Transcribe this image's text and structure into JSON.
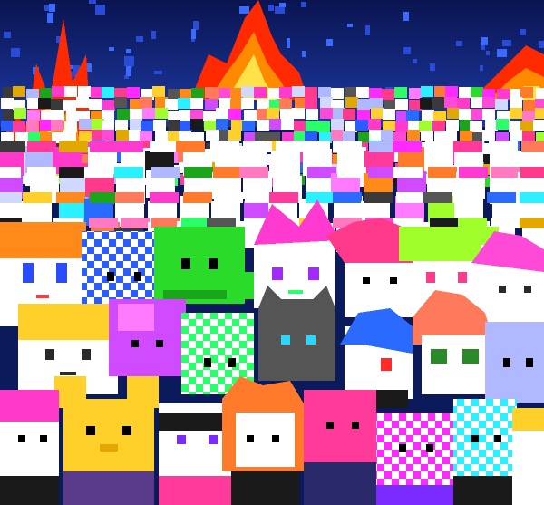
{
  "scene": {
    "palette": {
      "sky_top": "#0a1450",
      "sky_bottom": "#1d3aa5",
      "fire_outer": "#ff2a00",
      "fire_mid": "#ff8a00",
      "fire_core": "#ffe14a"
    },
    "characters": [
      {
        "name": "orange-hair-kid",
        "skin": "#ffffff",
        "hair": "#ff8a1a",
        "eye": "#2a4cff"
      },
      {
        "name": "blue-checker-head",
        "skin": "#2a5cff",
        "hair": "#ffffff",
        "eye": "#000000"
      },
      {
        "name": "green-dinosaur",
        "skin": "#2adb2a",
        "hair": "#1aa51a",
        "eye": "#000000"
      },
      {
        "name": "pink-flame-cat",
        "skin": "#ffffff",
        "hair": "#ff3ad0",
        "eye": "#a02aff"
      },
      {
        "name": "pink-hair-girl",
        "skin": "#ffffff",
        "hair": "#ff3a8a",
        "eye": "#000000"
      },
      {
        "name": "lime-hair-girl",
        "skin": "#ffffff",
        "hair": "#a0ff2a",
        "eye": "#ff3a8a"
      },
      {
        "name": "magenta-ghost",
        "skin": "#ffffff",
        "hair": "#ff4ad8",
        "eye": "#2a2a2a"
      },
      {
        "name": "yellow-hair-boy",
        "skin": "#ffffff",
        "hair": "#ffd02a",
        "eye": "#2a2a2a"
      },
      {
        "name": "purple-blob",
        "skin": "#d04aff",
        "hair": "#ff7aff",
        "eye": "#000000"
      },
      {
        "name": "green-checker-kid",
        "skin": "#ffffff",
        "hair": "#2aff6a",
        "eye": "#000000"
      },
      {
        "name": "gray-cat",
        "skin": "#555555",
        "hair": "#3a3a3a",
        "eye": "#2ad8ff"
      },
      {
        "name": "blue-hair-vampire",
        "skin": "#ffffff",
        "hair": "#2a6aff",
        "eye": "#ff2a2a"
      },
      {
        "name": "salmon-hair-skull",
        "skin": "#ffffff",
        "hair": "#ff7a5a",
        "eye": "#2a8a2a"
      },
      {
        "name": "lavender-kid",
        "skin": "#b0b8ff",
        "hair": "#d0d8ff",
        "eye": "#000000"
      },
      {
        "name": "yellow-mouse",
        "skin": "#ffd02a",
        "hair": "#e0a800",
        "eye": "#000000"
      },
      {
        "name": "white-cat",
        "skin": "#ffffff",
        "hair": "#1a1a1a",
        "eye": "#7a2aff"
      },
      {
        "name": "orange-fox",
        "skin": "#ffffff",
        "hair": "#ff7a2a",
        "eye": "#000000"
      },
      {
        "name": "hot-pink-blob",
        "skin": "#ff3a9a",
        "hair": "#ff7ac0",
        "eye": "#000000"
      },
      {
        "name": "magenta-checker-girl",
        "skin": "#ffffff",
        "hair": "#ff2aff",
        "eye": "#000000"
      },
      {
        "name": "cyan-checker-kid",
        "skin": "#ffffff",
        "hair": "#2af0ff",
        "eye": "#000000"
      },
      {
        "name": "pink-checker-girl",
        "skin": "#ffffff",
        "hair": "#ff3acb",
        "eye": "#000000"
      }
    ]
  }
}
